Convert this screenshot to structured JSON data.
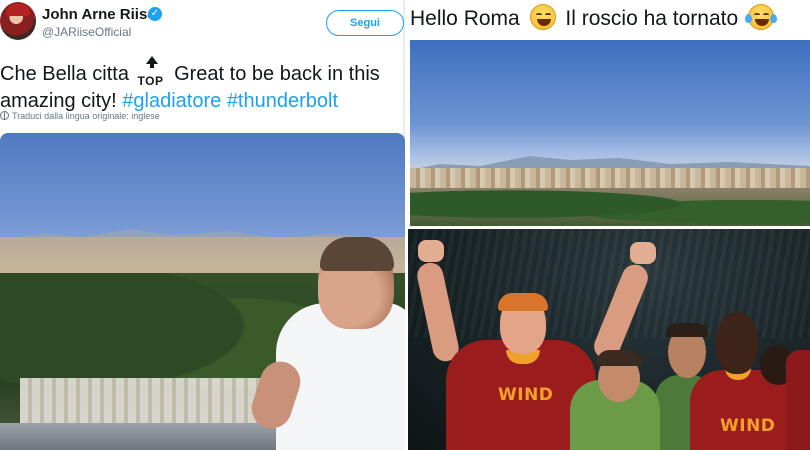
{
  "tweet": {
    "author_name": "John Arne Riise",
    "author_handle": "@JARiiseOfficial",
    "follow_label": "Segui",
    "verified_glyph": "✓",
    "text_part1": "Che Bella citta",
    "top_emoji_label": "TOP",
    "text_part2": "Great to be back in this amazing city!",
    "hashtag1": "#gladiatore",
    "hashtag2": "#thunderbolt",
    "translate_label": "Traduci dalla lingua originale: inglese",
    "icons": {
      "verified": "verified-badge-icon",
      "top": "top-arrow-emoji-icon",
      "translate": "globe-icon"
    },
    "colors": {
      "link": "#1da1f2",
      "secondary_text": "#657786",
      "verified": "#1da1f2"
    }
  },
  "caption": {
    "text1": "Hello Roma",
    "text2": "Il roscio ha tornato",
    "emoji1": "grinning-face-emoji",
    "emoji2": "face-with-tears-of-joy-emoji"
  },
  "players_photo": {
    "jersey_sponsor_main": "WIND",
    "jersey_sponsor_right": "WIND",
    "colors": {
      "jersey_red": "#9a1c1c",
      "jersey_orange": "#f1a12a",
      "bib_green": "#6b9b46"
    }
  }
}
